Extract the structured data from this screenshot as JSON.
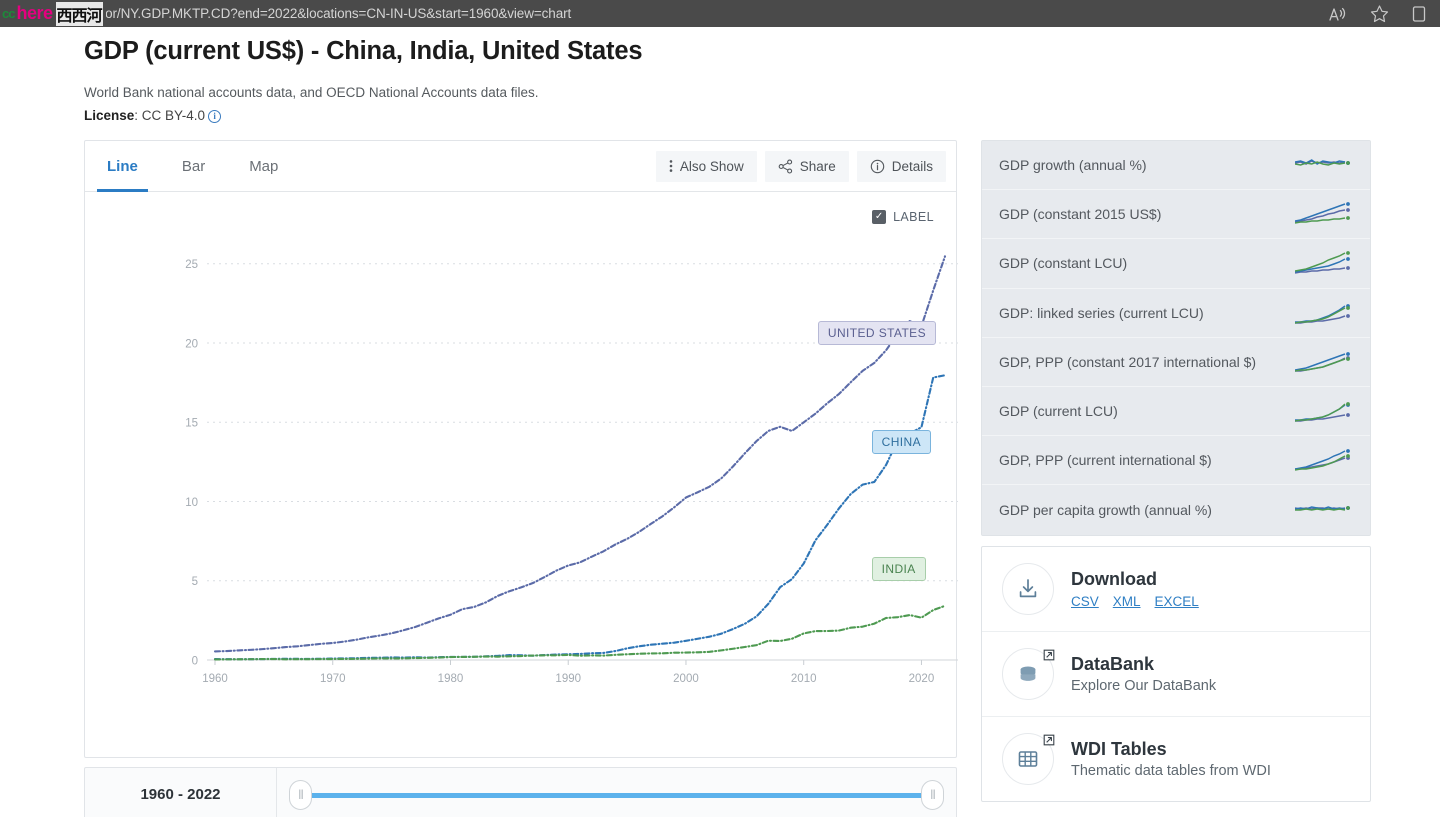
{
  "browser": {
    "url_visible": "dbank.org/indicator/NY.GDP.MKTP.CD?end=2022&locations=CN-IN-US&start=1960&view=chart",
    "watermark_cc": "cc",
    "watermark_here": "here",
    "watermark_cn": "西西河",
    "read_aloud_icon": "read-aloud-icon",
    "favorites_icon": "star-icon"
  },
  "header": {
    "title": "GDP (current US$) - China, India, United States",
    "source": "World Bank national accounts data, and OECD National Accounts data files.",
    "license_label": "License",
    "license_value": ": CC BY-4.0",
    "license_info_icon": "info-circle-icon"
  },
  "tabs": [
    {
      "label": "Line",
      "active": true
    },
    {
      "label": "Bar",
      "active": false
    },
    {
      "label": "Map",
      "active": false
    }
  ],
  "toolbar": [
    {
      "label": "Also Show",
      "icon": "vertical-dots-icon"
    },
    {
      "label": "Share",
      "icon": "share-nodes-icon"
    },
    {
      "label": "Details",
      "icon": "info-circle-icon"
    }
  ],
  "chart_controls": {
    "label_checkbox_text": "LABEL",
    "label_checkbox_checked": true,
    "checkbox_icon": "checkmark-icon"
  },
  "slider": {
    "range_text": "1960 - 2022",
    "start_year": 1960,
    "end_year": 2022,
    "handle_left_icon": "grip-handle-icon",
    "handle_right_icon": "grip-handle-icon"
  },
  "indicators": [
    {
      "label": "GDP growth (annual %)"
    },
    {
      "label": "GDP (constant 2015 US$)"
    },
    {
      "label": "GDP (constant LCU)"
    },
    {
      "label": "GDP: linked series (current LCU)"
    },
    {
      "label": "GDP, PPP (constant 2017 international $)"
    },
    {
      "label": "GDP (current LCU)"
    },
    {
      "label": "GDP, PPP (current international $)"
    },
    {
      "label": "GDP per capita growth (annual %)"
    }
  ],
  "actions": [
    {
      "title": "Download",
      "icon": "download-icon",
      "external": false,
      "links": [
        "CSV",
        "XML",
        "EXCEL"
      ]
    },
    {
      "title": "DataBank",
      "subtitle": "Explore Our DataBank",
      "icon": "database-icon",
      "external": true,
      "links": []
    },
    {
      "title": "WDI Tables",
      "subtitle": "Thematic data tables from WDI",
      "icon": "table-grid-icon",
      "external": true,
      "links": []
    }
  ],
  "chart_data": {
    "type": "line",
    "title": "GDP (current US$) - China, India, United States",
    "xlabel": "",
    "ylabel": "",
    "unit": "trillions of current US$",
    "xlim": [
      1960,
      2022
    ],
    "ylim": [
      0,
      27
    ],
    "yticks": [
      0,
      5,
      10,
      15,
      20,
      25
    ],
    "xticks": [
      1960,
      1970,
      1980,
      1990,
      2000,
      2010,
      2020
    ],
    "grid": true,
    "legend": "inline-labels",
    "x": [
      1960,
      1961,
      1962,
      1963,
      1964,
      1965,
      1966,
      1967,
      1968,
      1969,
      1970,
      1971,
      1972,
      1973,
      1974,
      1975,
      1976,
      1977,
      1978,
      1979,
      1980,
      1981,
      1982,
      1983,
      1984,
      1985,
      1986,
      1987,
      1988,
      1989,
      1990,
      1991,
      1992,
      1993,
      1994,
      1995,
      1996,
      1997,
      1998,
      1999,
      2000,
      2001,
      2002,
      2003,
      2004,
      2005,
      2006,
      2007,
      2008,
      2009,
      2010,
      2011,
      2012,
      2013,
      2014,
      2015,
      2016,
      2017,
      2018,
      2019,
      2020,
      2021,
      2022
    ],
    "series": [
      {
        "name": "UNITED STATES",
        "color": "#5b6ba8",
        "label_text": "UNITED STATES",
        "values": [
          0.543,
          0.563,
          0.605,
          0.639,
          0.686,
          0.744,
          0.815,
          0.862,
          0.943,
          1.02,
          1.073,
          1.165,
          1.279,
          1.426,
          1.545,
          1.685,
          1.873,
          2.082,
          2.352,
          2.627,
          2.857,
          3.207,
          3.344,
          3.634,
          4.038,
          4.339,
          4.58,
          4.855,
          5.236,
          5.642,
          5.963,
          6.158,
          6.52,
          6.859,
          7.287,
          7.64,
          8.073,
          8.578,
          9.063,
          9.631,
          10.251,
          10.582,
          10.936,
          11.458,
          12.214,
          13.037,
          13.815,
          14.452,
          14.713,
          14.449,
          14.992,
          15.543,
          16.197,
          16.785,
          17.527,
          18.238,
          18.745,
          19.543,
          20.612,
          21.381,
          21.06,
          23.315,
          25.463
        ]
      },
      {
        "name": "CHINA",
        "color": "#2e75b6",
        "label_text": "CHINA",
        "values": [
          0.06,
          0.05,
          0.047,
          0.051,
          0.059,
          0.07,
          0.076,
          0.072,
          0.07,
          0.079,
          0.093,
          0.099,
          0.113,
          0.138,
          0.144,
          0.163,
          0.153,
          0.174,
          0.15,
          0.178,
          0.191,
          0.196,
          0.205,
          0.23,
          0.26,
          0.309,
          0.3,
          0.273,
          0.312,
          0.348,
          0.361,
          0.383,
          0.427,
          0.445,
          0.564,
          0.734,
          0.864,
          0.962,
          1.029,
          1.094,
          1.211,
          1.339,
          1.471,
          1.66,
          1.955,
          2.286,
          2.752,
          3.55,
          4.594,
          5.102,
          6.087,
          7.552,
          8.532,
          9.57,
          10.476,
          11.062,
          11.233,
          12.31,
          13.895,
          14.28,
          14.688,
          17.82,
          17.963
        ]
      },
      {
        "name": "INDIA",
        "color": "#4e9a51",
        "label_text": "INDIA",
        "values": [
          0.037,
          0.039,
          0.042,
          0.048,
          0.056,
          0.059,
          0.045,
          0.05,
          0.053,
          0.058,
          0.062,
          0.067,
          0.071,
          0.085,
          0.099,
          0.098,
          0.102,
          0.121,
          0.137,
          0.152,
          0.186,
          0.193,
          0.2,
          0.218,
          0.212,
          0.232,
          0.249,
          0.279,
          0.297,
          0.296,
          0.321,
          0.27,
          0.288,
          0.279,
          0.327,
          0.36,
          0.392,
          0.416,
          0.421,
          0.459,
          0.468,
          0.486,
          0.514,
          0.608,
          0.71,
          0.82,
          0.94,
          1.217,
          1.199,
          1.342,
          1.676,
          1.823,
          1.828,
          1.857,
          2.039,
          2.104,
          2.295,
          2.651,
          2.703,
          2.835,
          2.671,
          3.15,
          3.416
        ]
      }
    ],
    "annotations": [
      {
        "text": "UNITED STATES",
        "series": "UNITED STATES",
        "near_year": 2018
      },
      {
        "text": "CHINA",
        "series": "CHINA",
        "near_year": 2019
      },
      {
        "text": "INDIA",
        "series": "INDIA",
        "near_year": 2019
      }
    ]
  }
}
